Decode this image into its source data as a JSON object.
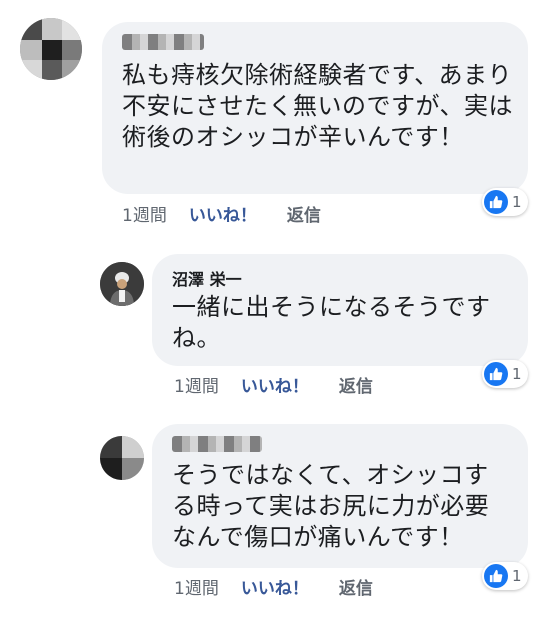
{
  "comments": [
    {
      "author": "",
      "text": "私も痔核欠除術経験者です、あまり不安にさせたく無いのですが、実は術後のオシッコが辛いんです！",
      "time": "1週間",
      "like_label": "いいね！",
      "reply_label": "返信",
      "reaction_count": "1"
    },
    {
      "author": "沼澤 栄一",
      "text": "一緒に出そうになるそうですね。",
      "time": "1週間",
      "like_label": "いいね！",
      "reply_label": "返信",
      "reaction_count": "1"
    },
    {
      "author": "",
      "text": "そうではなくて、オシッコする時って実はお尻に力が必要なんで傷口が痛いんです！",
      "time": "1週間",
      "like_label": "いいね！",
      "reply_label": "返信",
      "reaction_count": "1"
    }
  ],
  "colors": {
    "bubble": "#f0f2f5",
    "link": "#385898",
    "meta": "#606770",
    "like_badge": "#1877f2"
  },
  "icons": {
    "reaction": "thumbs-up-icon"
  }
}
